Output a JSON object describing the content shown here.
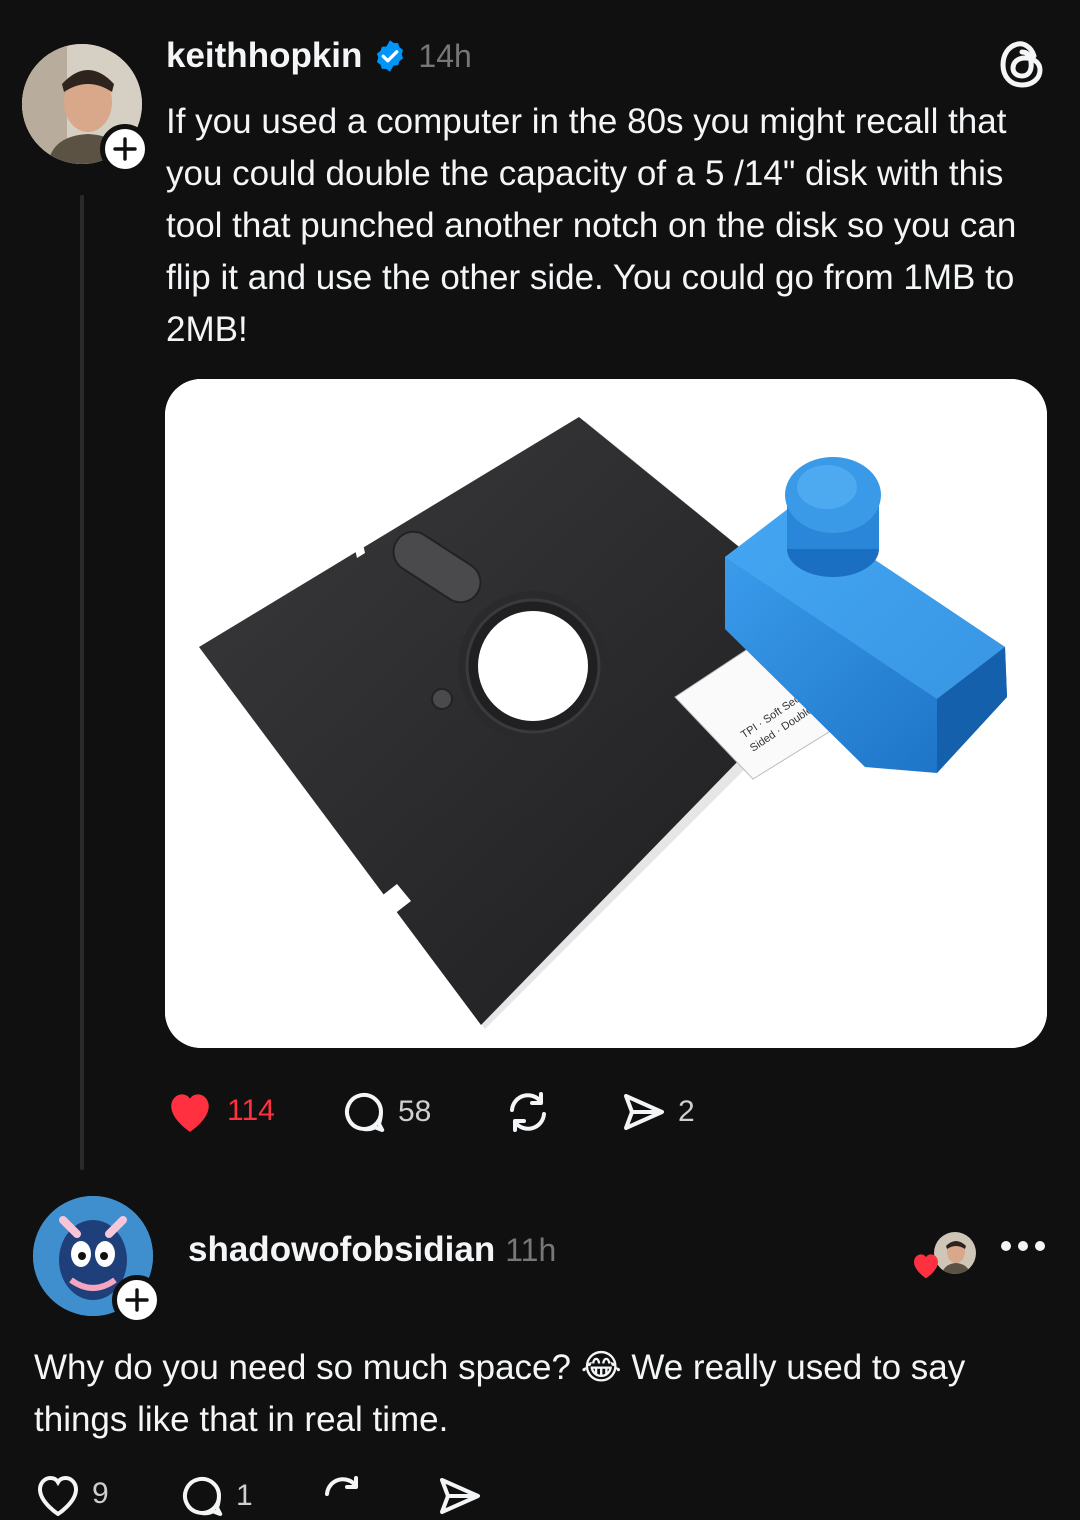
{
  "post": {
    "username": "keithhopkin",
    "time": "14h",
    "text": "If you used a computer in the 80s you might recall that you could double the capacity of a 5 /14\" disk with this tool that punched another notch on the disk so you can flip it and use the other side. You could go from 1MB to 2MB!",
    "image_alt": "5¼\" floppy disk with blue notch punch tool",
    "disk_label": {
      "line1": "Sided · Double Density",
      "line2": "TPI · Soft Sectored"
    },
    "actions": {
      "likes": "114",
      "replies": "58",
      "reposts": "",
      "shares": "2"
    },
    "like_color": "#ff3040"
  },
  "reply": {
    "username": "shadowofobsidian",
    "time": "11h",
    "text": "Why do you need so much space? 😂 We really used to say things like that in real time.",
    "actions": {
      "likes": "9",
      "replies": "1"
    }
  },
  "icons": {
    "verified": "verified-badge-icon",
    "threads_logo": "threads-logo-icon",
    "more": "more-options-icon"
  }
}
